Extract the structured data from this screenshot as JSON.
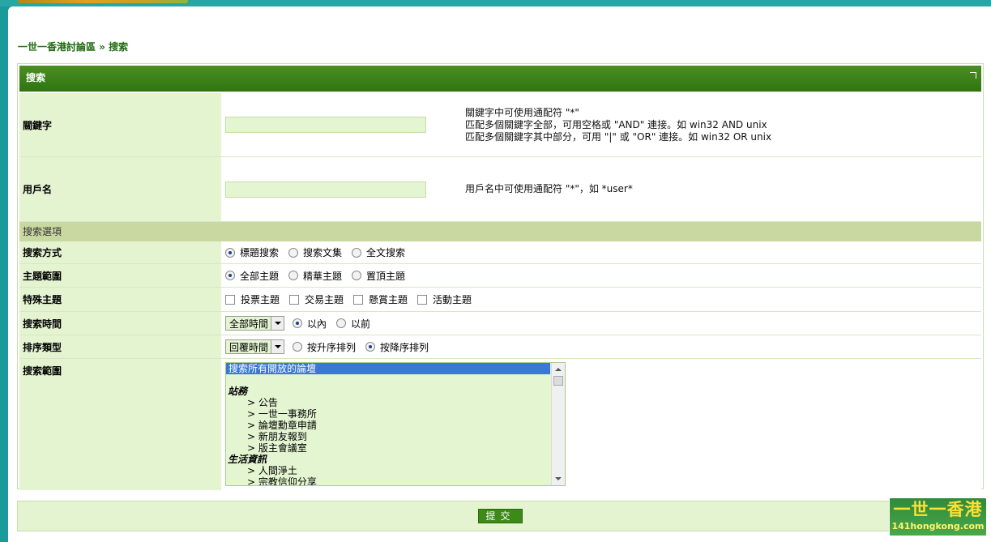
{
  "breadcrumb": "一世一香港討論區 » 搜索",
  "panel": {
    "title": "搜索"
  },
  "keyword": {
    "label": "關鍵字",
    "value": "",
    "hints": [
      "關鍵字中可使用通配符 \"*\"",
      "匹配多個關鍵字全部，可用空格或 \"AND\" 連接。如 win32 AND unix",
      "匹配多個關鍵字其中部分，可用 \"|\" 或 \"OR\" 連接。如 win32 OR unix"
    ]
  },
  "username": {
    "label": "用戶名",
    "value": "",
    "hint": "用戶名中可使用通配符 \"*\"，如 *user*"
  },
  "options_header": "搜索選項",
  "search_mode": {
    "label": "搜索方式",
    "options": [
      "標題搜索",
      "搜索文集",
      "全文搜索"
    ],
    "selected": "標題搜索"
  },
  "thread_scope": {
    "label": "主題範圍",
    "options": [
      "全部主題",
      "精華主題",
      "置頂主題"
    ],
    "selected": "全部主題"
  },
  "special_threads": {
    "label": "特殊主題",
    "options": [
      "投票主題",
      "交易主題",
      "懸賞主題",
      "活動主題"
    ]
  },
  "search_time": {
    "label": "搜索時間",
    "select_value": "全部時間",
    "options": [
      "以內",
      "以前"
    ],
    "selected": "以內"
  },
  "sort_type": {
    "label": "排序類型",
    "select_value": "回覆時間",
    "options": [
      "按升序排列",
      "按降序排列"
    ],
    "selected": "按降序排列"
  },
  "search_range": {
    "label": "搜索範圍",
    "selected_item": "搜索所有開放的論壇",
    "groups": [
      {
        "name": "站務",
        "items": [
          "> 公告",
          "> 一世一事務所",
          "> 論壇勳章申請",
          "> 新朋友報到",
          "> 版主會議室"
        ]
      },
      {
        "name": "生活資訊",
        "items": [
          "> 人間淨土",
          "> 宗教信仰分享"
        ]
      }
    ]
  },
  "submit_label": "提交",
  "watermark": {
    "brand": "一世一香港",
    "domain": "141hongkong.com"
  }
}
